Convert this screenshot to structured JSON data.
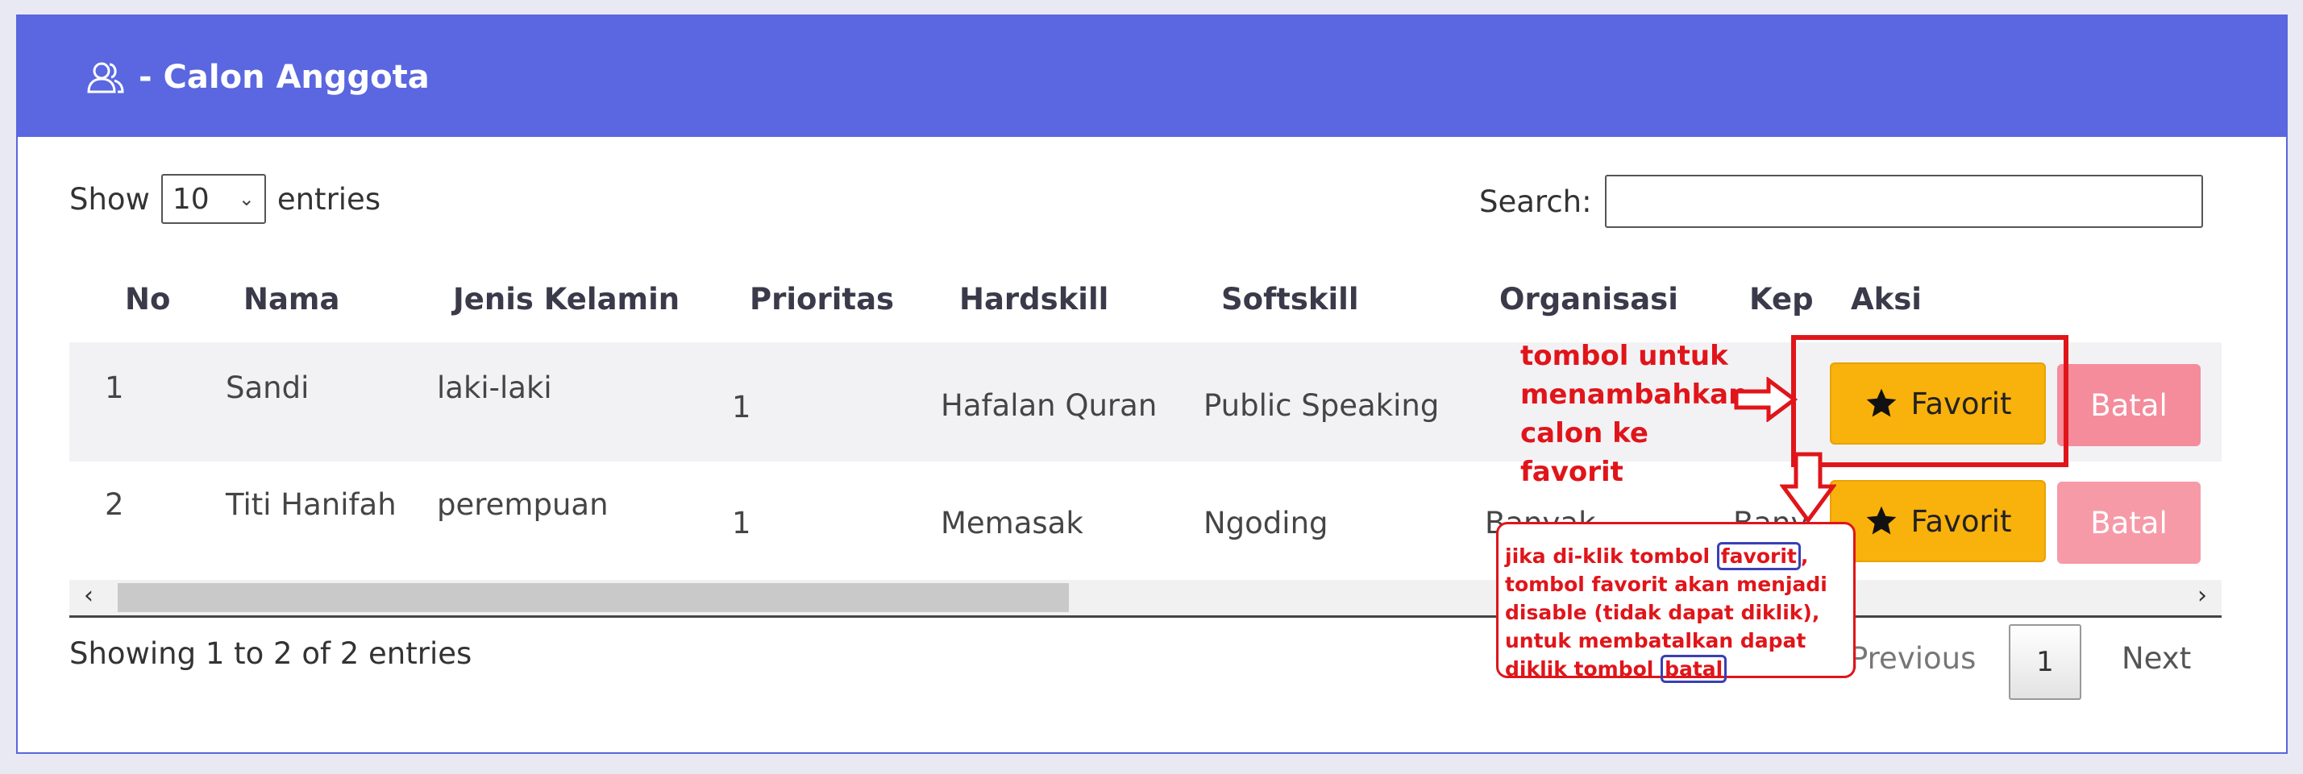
{
  "header": {
    "title": "- Calon Anggota",
    "icon": "users-icon",
    "bg": "#5a67e0"
  },
  "controls": {
    "show_label": "Show",
    "page_size": "10",
    "entries_label": "entries",
    "search_label": "Search:",
    "search_value": ""
  },
  "table": {
    "columns": [
      "No",
      "Nama",
      "Jenis Kelamin",
      "Prioritas",
      "Hardskill",
      "Softskill",
      "Organisasi",
      "Kep",
      "Aksi"
    ],
    "rows": [
      {
        "no": "1",
        "nama": "Sandi",
        "jk": "laki-laki",
        "prioritas": "1",
        "hardskill": "Hafalan Quran",
        "softskill": "Public Speaking",
        "organisasi": "",
        "kep": ""
      },
      {
        "no": "2",
        "nama": "Titi Hanifah",
        "jk": "perempuan",
        "prioritas": "1",
        "hardskill": "Memasak",
        "softskill": "Ngoding",
        "organisasi": "Banyak",
        "kep": "Bany"
      }
    ],
    "fav_label": "Favorit",
    "batal_label": "Batal"
  },
  "footer": {
    "info": "Showing 1 to 2 of 2 entries",
    "previous": "Previous",
    "page": "1",
    "next": "Next"
  },
  "annotations": {
    "note1": "tombol untuk menambahkan calon ke favorit",
    "note2_a": "jika di-klik tombol ",
    "note2_fav": "favorit",
    "note2_b": ", tombol favorit akan menjadi disable (tidak dapat diklik), untuk membatalkan dapat diklik tombol ",
    "note2_batal": "batal",
    "color": "#e0151a"
  }
}
